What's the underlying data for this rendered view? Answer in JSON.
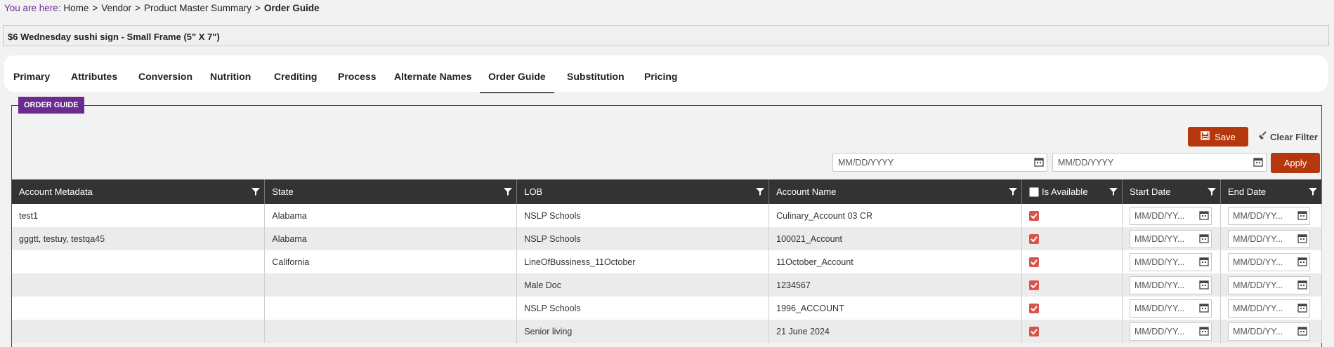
{
  "breadcrumb": {
    "prefix": "You are here:",
    "items": [
      "Home",
      "Vendor",
      "Product Master Summary"
    ],
    "current": "Order Guide"
  },
  "product_title": "$6 Wednesday sushi sign - Small Frame (5\" X 7\")",
  "tabs": [
    "Primary",
    "Attributes",
    "Conversion",
    "Nutrition",
    "Crediting",
    "Process",
    "Alternate Names",
    "Order Guide",
    "Substitution",
    "Pricing"
  ],
  "active_tab": "Order Guide",
  "section_title": "ORDER GUIDE",
  "toolbar": {
    "save_label": "Save",
    "clear_filter_label": "Clear Filter",
    "apply_label": "Apply",
    "start_placeholder": "MM/DD/YYYY",
    "end_placeholder": "MM/DD/YYYY"
  },
  "table": {
    "headers": [
      "Account Metadata",
      "State",
      "LOB",
      "Account Name",
      "Is Available",
      "Start Date",
      "End Date"
    ],
    "date_placeholder": "MM/DD/YY...",
    "rows": [
      {
        "metadata": "test1",
        "state": "Alabama",
        "lob": "NSLP Schools",
        "account": "Culinary_Account 03 CR",
        "available": true
      },
      {
        "metadata": "gggtt, testuy, testqa45",
        "state": "Alabama",
        "lob": "NSLP Schools",
        "account": "100021_Account",
        "available": true
      },
      {
        "metadata": "",
        "state": "California",
        "lob": "LineOfBussiness_11October",
        "account": "11October_Account",
        "available": true
      },
      {
        "metadata": "",
        "state": "",
        "lob": "Male Doc",
        "account": "1234567",
        "available": true
      },
      {
        "metadata": "",
        "state": "",
        "lob": "NSLP Schools",
        "account": "1996_ACCOUNT",
        "available": true
      },
      {
        "metadata": "",
        "state": "",
        "lob": "Senior living",
        "account": "21 June 2024",
        "available": true
      }
    ]
  },
  "colors": {
    "accent": "#6b2c91",
    "button": "#b5370d",
    "header_bg": "#333333",
    "checkbox": "#d9534f"
  }
}
